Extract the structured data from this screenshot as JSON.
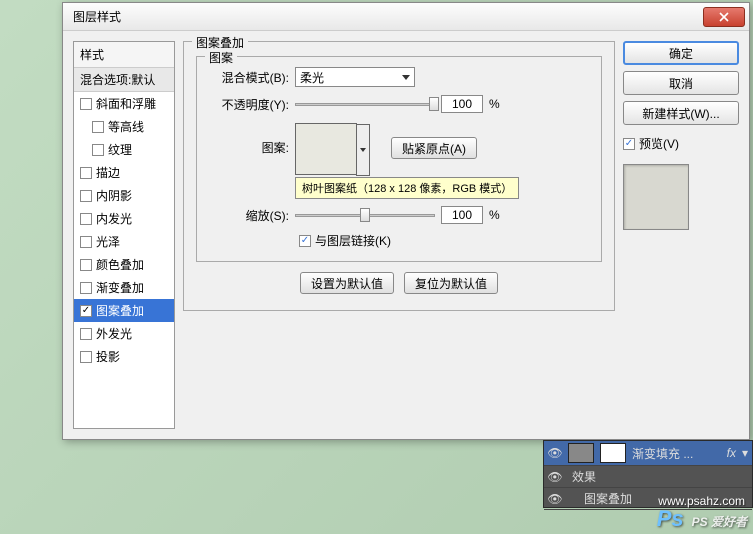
{
  "dialog": {
    "title": "图层样式",
    "styles": {
      "header": "样式",
      "blend_options": "混合选项:默认",
      "items": [
        {
          "label": "斜面和浮雕",
          "checked": false,
          "indent": false
        },
        {
          "label": "等高线",
          "checked": false,
          "indent": true
        },
        {
          "label": "纹理",
          "checked": false,
          "indent": true
        },
        {
          "label": "描边",
          "checked": false,
          "indent": false
        },
        {
          "label": "内阴影",
          "checked": false,
          "indent": false
        },
        {
          "label": "内发光",
          "checked": false,
          "indent": false
        },
        {
          "label": "光泽",
          "checked": false,
          "indent": false
        },
        {
          "label": "颜色叠加",
          "checked": false,
          "indent": false
        },
        {
          "label": "渐变叠加",
          "checked": false,
          "indent": false
        },
        {
          "label": "图案叠加",
          "checked": true,
          "indent": false,
          "selected": true
        },
        {
          "label": "外发光",
          "checked": false,
          "indent": false
        },
        {
          "label": "投影",
          "checked": false,
          "indent": false
        }
      ]
    },
    "section": {
      "title": "图案叠加",
      "group": "图案",
      "blend_mode_label": "混合模式(B):",
      "blend_mode_value": "柔光",
      "opacity_label": "不透明度(Y):",
      "opacity_value": "100",
      "percent": "%",
      "pattern_label": "图案:",
      "snap_origin": "贴紧原点(A)",
      "tooltip": "树叶图案纸（128 x 128 像素，RGB 模式）",
      "scale_label": "缩放(S):",
      "scale_value": "100",
      "link_label": "与图层链接(K)",
      "make_default": "设置为默认值",
      "reset_default": "复位为默认值"
    },
    "actions": {
      "ok": "确定",
      "cancel": "取消",
      "new_style": "新建样式(W)...",
      "preview": "预览(V)"
    }
  },
  "layers": {
    "layer_name": "渐变填充 ...",
    "fx": "fx",
    "effects": "效果",
    "pattern_overlay": "图案叠加"
  },
  "watermark": {
    "text": "PS 爱好者",
    "url": "www.psahz.com"
  }
}
